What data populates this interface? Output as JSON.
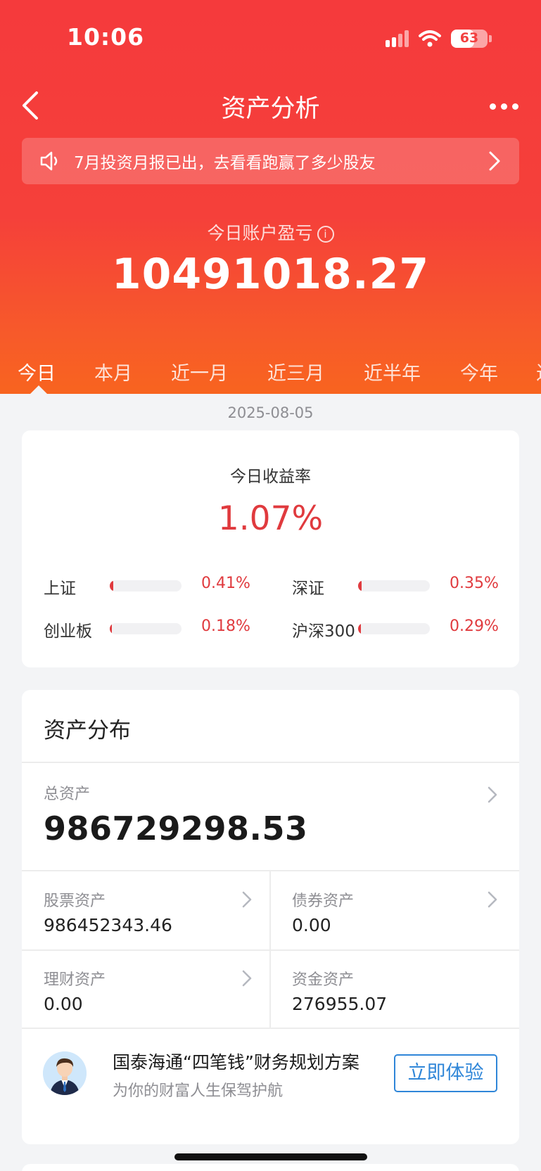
{
  "status_bar": {
    "time": "10:06",
    "battery": "63",
    "battery_level": 0.63
  },
  "nav": {
    "title": "资产分析",
    "back_icon": "chevron-left-icon",
    "more_icon": "more-dots-icon"
  },
  "notice": {
    "text": "7月投资月报已出，去看看跑赢了多少股友",
    "icon": "speaker-icon"
  },
  "pnl": {
    "label": "今日账户盈亏",
    "value": "10491018.27"
  },
  "tabs": [
    "今日",
    "本月",
    "近一月",
    "近三月",
    "近半年",
    "今年",
    "近"
  ],
  "date": "2025-08-05",
  "returns": {
    "title": "今日收益率",
    "value": "1.07%",
    "indices": [
      {
        "name": "上证",
        "value": "0.41%",
        "fill": 0.05
      },
      {
        "name": "深证",
        "value": "0.35%",
        "fill": 0.05
      },
      {
        "name": "创业板",
        "value": "0.18%",
        "fill": 0.03
      },
      {
        "name": "沪深300",
        "value": "0.29%",
        "fill": 0.04
      }
    ]
  },
  "assets": {
    "title": "资产分布",
    "total_label": "总资产",
    "total_value": "986729298.53",
    "items": [
      {
        "label": "股票资产",
        "value": "986452343.46"
      },
      {
        "label": "债券资产",
        "value": "0.00"
      },
      {
        "label": "理财资产",
        "value": "0.00"
      },
      {
        "label": "资金资产",
        "value": "276955.07"
      }
    ]
  },
  "plan": {
    "title": "国泰海通“四笔钱”财务规划方案",
    "subtitle": "为你的财富人生保驾护航",
    "button": "立即体验"
  },
  "colors": {
    "brand_red": "#f53a3c",
    "gain_red": "#e03a3e",
    "link_blue": "#2f86d8"
  }
}
